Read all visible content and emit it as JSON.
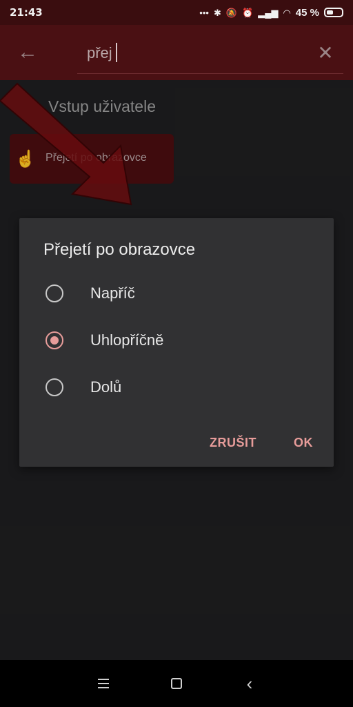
{
  "status_bar": {
    "time": "21:43",
    "dots": "•••",
    "battery": "45 %",
    "battery_level": 0.45,
    "icons": [
      "bluetooth-icon",
      "mute-icon",
      "alarm-icon",
      "signal-icon",
      "wifi-icon"
    ]
  },
  "app_bar": {
    "search_value": "přej",
    "icons": [
      "back-arrow-icon",
      "close-icon"
    ]
  },
  "results": {
    "section_title": "Vstup uživatele",
    "item_label": "Přejetí po obrazovce",
    "item_icon": "hand-pointer-icon"
  },
  "dialog": {
    "title": "Přejetí po obrazovce",
    "options": [
      {
        "label": "Napříč",
        "selected": false
      },
      {
        "label": "Uhlopříčně",
        "selected": true
      },
      {
        "label": "Dolů",
        "selected": false
      }
    ],
    "cancel_label": "ZRUŠIT",
    "ok_label": "OK"
  },
  "colors": {
    "accent": "#e79c9a",
    "appbar": "#4a1013",
    "dialog_bg": "#313133"
  },
  "nav_bar": {
    "icons": [
      "menu-icon",
      "home-icon",
      "back-icon"
    ]
  }
}
